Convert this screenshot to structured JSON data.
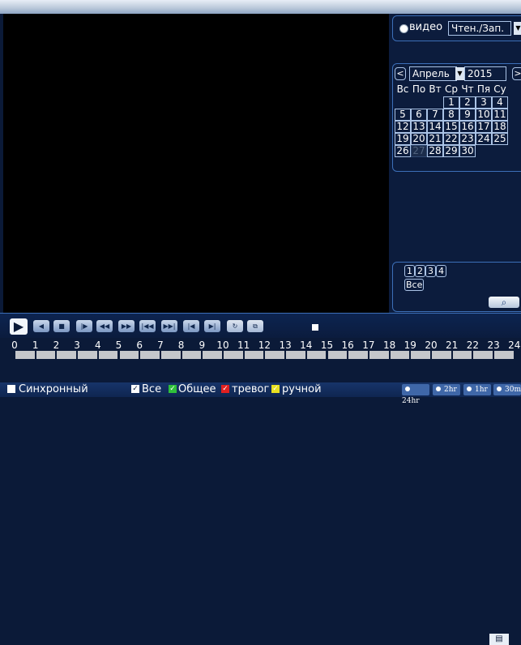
{
  "mode": {
    "label": "видео",
    "select_value": "Чтен./Зап."
  },
  "calendar": {
    "prev": "<",
    "next": ">",
    "month": "Апрель",
    "year": "2015",
    "weekdays": [
      "Вс",
      "По",
      "Вт",
      "Ср",
      "Чт",
      "Пя",
      "Су"
    ],
    "days": [
      "1",
      "2",
      "3",
      "4",
      "5",
      "6",
      "7",
      "8",
      "9",
      "10",
      "11",
      "12",
      "13",
      "14",
      "15",
      "16",
      "17",
      "18",
      "19",
      "20",
      "21",
      "22",
      "23",
      "24",
      "25",
      "26",
      "27",
      "28",
      "29",
      "30"
    ],
    "selected_day": "27"
  },
  "channels": {
    "items": [
      "1",
      "2",
      "3",
      "4"
    ],
    "all_label": "Все"
  },
  "controls": {
    "play": "▶",
    "buttons": [
      "◀",
      "■",
      "|▶",
      "◀◀",
      "▶▶",
      "|◀◀",
      "▶▶|",
      "|◀",
      "▶|",
      "↻",
      "⧉"
    ],
    "list_icon": "▤"
  },
  "timeline": {
    "hours": [
      "0",
      "1",
      "2",
      "3",
      "4",
      "5",
      "6",
      "7",
      "8",
      "9",
      "10",
      "11",
      "12",
      "13",
      "14",
      "15",
      "16",
      "17",
      "18",
      "19",
      "20",
      "21",
      "22",
      "23",
      "24"
    ]
  },
  "filters": {
    "sync_label": "Синхронный",
    "all_label": "Все",
    "general_label": "Общее",
    "alarm_label": "тревог",
    "manual_label": "ручной",
    "colors": {
      "all": "#ffffff",
      "general": "#2fbf3a",
      "alarm": "#e02020",
      "manual": "#e8e020"
    }
  },
  "zoom": [
    "24hr",
    "2hr",
    "1hr",
    "30m"
  ],
  "icons": {
    "search": "search-icon",
    "radio": "radio-selected-icon"
  }
}
